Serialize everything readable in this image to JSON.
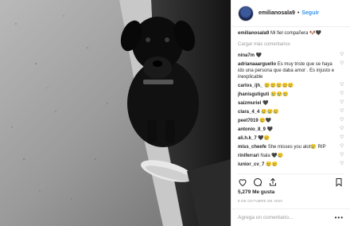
{
  "photo": {
    "alt": ""
  },
  "header": {
    "username": "emilianosala9",
    "separator": "•",
    "follow_label": "Seguir"
  },
  "caption": {
    "username": "emilianosala9",
    "text": "Mi fiel compañera 🐶🖤"
  },
  "load_more_label": "Cargar más comentarios",
  "comments": [
    {
      "user": "nina7m",
      "text": "🖤"
    },
    {
      "user": "adrianaaarguello",
      "text": "Es muy triste que se haya ido una persona que daba amor . Es injusto e inexplicable"
    },
    {
      "user": "carlos_ijh_",
      "text": "😢😢😢😢😢"
    },
    {
      "user": "jhanisgutiguti",
      "text": "😢😢😢"
    },
    {
      "user": "saizmuriel",
      "text": "🖤"
    },
    {
      "user": "clara_4_4",
      "text": "😢😢😢"
    },
    {
      "user": "peet7019",
      "text": "😢🖤"
    },
    {
      "user": "antonio_8_9",
      "text": "🖤"
    },
    {
      "user": "ali.h.k_7",
      "text": "🖤😢"
    },
    {
      "user": "miss_cheefe",
      "text": "She misses you alot😢 RIP"
    },
    {
      "user": "riniferrari",
      "text": "Nala 🖤😢"
    },
    {
      "user": "iunior_cv_7",
      "text": "😢😢"
    }
  ],
  "icons": {
    "like": "heart-icon",
    "comment": "comment-icon",
    "share": "share-icon",
    "save": "bookmark-icon",
    "comment_like": "heart-icon",
    "options": "more-options-icon"
  },
  "likes_text": "5,279 Me gusta",
  "date_text": "8 DE OCTUBRE DE 2020",
  "add_comment": {
    "placeholder": "Agrega un comentario...",
    "options_glyph": "•••"
  }
}
